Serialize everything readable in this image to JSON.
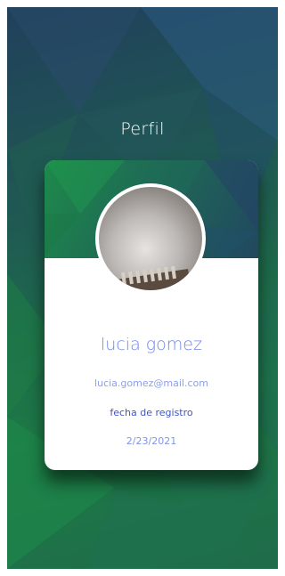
{
  "screen": {
    "title": "Perfil"
  },
  "profile": {
    "name": "lucia gomez",
    "email": "lucia.gomez@mail.com",
    "registration_label": "fecha de registro",
    "registration_date": "2/23/2021"
  },
  "colors": {
    "background_top": "#21405c",
    "background_bottom": "#1d7a45",
    "name_text": "#6e86ea",
    "label_text": "#3f56c8",
    "card": "#ffffff"
  }
}
